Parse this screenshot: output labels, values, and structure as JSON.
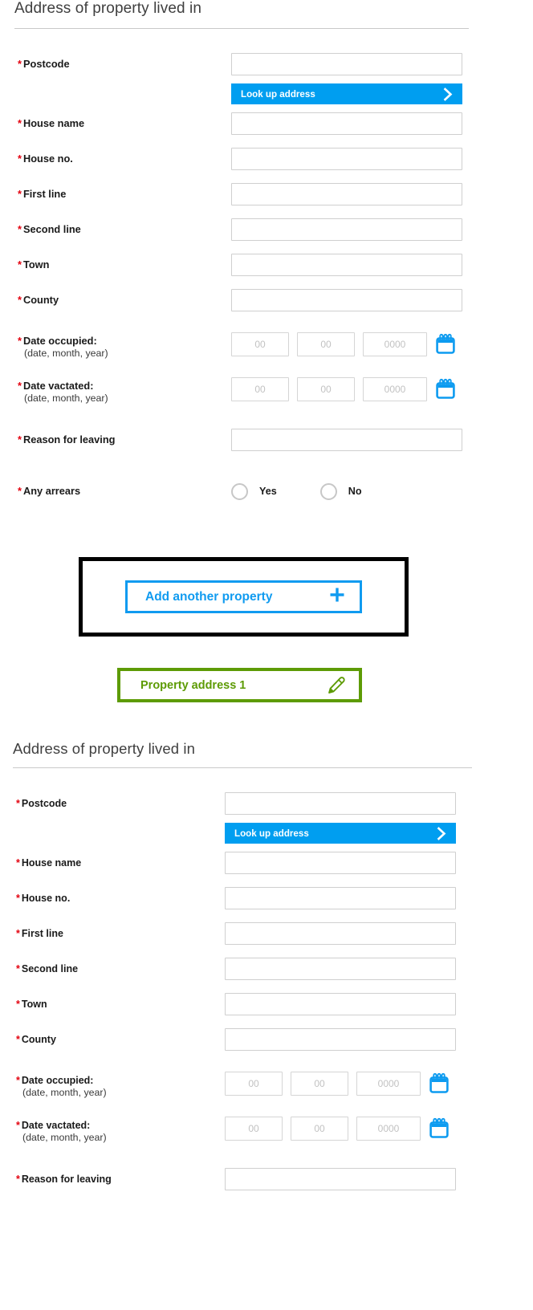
{
  "colors": {
    "accent_blue": "#009ef0",
    "add_button_blue": "#109bf0",
    "required_red": "#e3000f",
    "chip_green": "#5d9b05",
    "heading_gray": "#3f3f3f",
    "input_border": "#cfcfcf",
    "callout_black": "#000000"
  },
  "sections": [
    {
      "heading": "Address of property lived in",
      "fields": {
        "postcode": {
          "label": "Postcode",
          "required_marker": "*",
          "value": "",
          "placeholder": ""
        },
        "house_name": {
          "label": "House name",
          "required_marker": "*",
          "value": "",
          "placeholder": ""
        },
        "house_no": {
          "label": "House no.",
          "required_marker": "*",
          "value": "",
          "placeholder": ""
        },
        "first_line": {
          "label": "First line",
          "required_marker": "*",
          "value": "",
          "placeholder": ""
        },
        "second_line": {
          "label": "Second line",
          "required_marker": "*",
          "value": "",
          "placeholder": ""
        },
        "town": {
          "label": "Town",
          "required_marker": "*",
          "value": "",
          "placeholder": ""
        },
        "county": {
          "label": "County",
          "required_marker": "*",
          "value": "",
          "placeholder": ""
        },
        "reason_for_leaving": {
          "label": "Reason for leaving",
          "required_marker": "*",
          "value": "",
          "placeholder": ""
        }
      },
      "lookup_button": {
        "label": "Look up address",
        "icon": "chevron-right-icon"
      },
      "date_occupied": {
        "label": "Date occupied:",
        "sub_label": "(date, month, year)",
        "required_marker": "*",
        "day": {
          "value": "",
          "placeholder": "00"
        },
        "month": {
          "value": "",
          "placeholder": "00"
        },
        "year": {
          "value": "",
          "placeholder": "0000"
        },
        "icon": "calendar-icon"
      },
      "date_vacated": {
        "label": "Date vactated:",
        "sub_label": "(date, month, year)",
        "required_marker": "*",
        "day": {
          "value": "",
          "placeholder": "00"
        },
        "month": {
          "value": "",
          "placeholder": "00"
        },
        "year": {
          "value": "",
          "placeholder": "0000"
        },
        "icon": "calendar-icon"
      },
      "arrears": {
        "label": "Any arrears",
        "required_marker": "*",
        "options": [
          {
            "label": "Yes",
            "selected": false
          },
          {
            "label": "No",
            "selected": false
          }
        ]
      }
    },
    {
      "heading": "Address of property lived in",
      "fields": {
        "postcode": {
          "label": "Postcode",
          "required_marker": "*",
          "value": "",
          "placeholder": ""
        },
        "house_name": {
          "label": "House name",
          "required_marker": "*",
          "value": "",
          "placeholder": ""
        },
        "house_no": {
          "label": "House no.",
          "required_marker": "*",
          "value": "",
          "placeholder": ""
        },
        "first_line": {
          "label": "First line",
          "required_marker": "*",
          "value": "",
          "placeholder": ""
        },
        "second_line": {
          "label": "Second line",
          "required_marker": "*",
          "value": "",
          "placeholder": ""
        },
        "town": {
          "label": "Town",
          "required_marker": "*",
          "value": "",
          "placeholder": ""
        },
        "county": {
          "label": "County",
          "required_marker": "*",
          "value": "",
          "placeholder": ""
        },
        "reason_for_leaving": {
          "label": "Reason for leaving",
          "required_marker": "*",
          "value": "",
          "placeholder": ""
        }
      },
      "lookup_button": {
        "label": "Look up address",
        "icon": "chevron-right-icon"
      },
      "date_occupied": {
        "label": "Date occupied:",
        "sub_label": "(date, month, year)",
        "required_marker": "*",
        "day": {
          "value": "",
          "placeholder": "00"
        },
        "month": {
          "value": "",
          "placeholder": "00"
        },
        "year": {
          "value": "",
          "placeholder": "0000"
        },
        "icon": "calendar-icon"
      },
      "date_vacated": {
        "label": "Date vactated:",
        "sub_label": "(date, month, year)",
        "required_marker": "*",
        "day": {
          "value": "",
          "placeholder": "00"
        },
        "month": {
          "value": "",
          "placeholder": "00"
        },
        "year": {
          "value": "",
          "placeholder": "0000"
        },
        "icon": "calendar-icon"
      }
    }
  ],
  "add_property": {
    "label": "Add another property",
    "icon": "plus-icon"
  },
  "property_chip": {
    "label": "Property address 1",
    "icon": "pencil-edit-icon"
  }
}
